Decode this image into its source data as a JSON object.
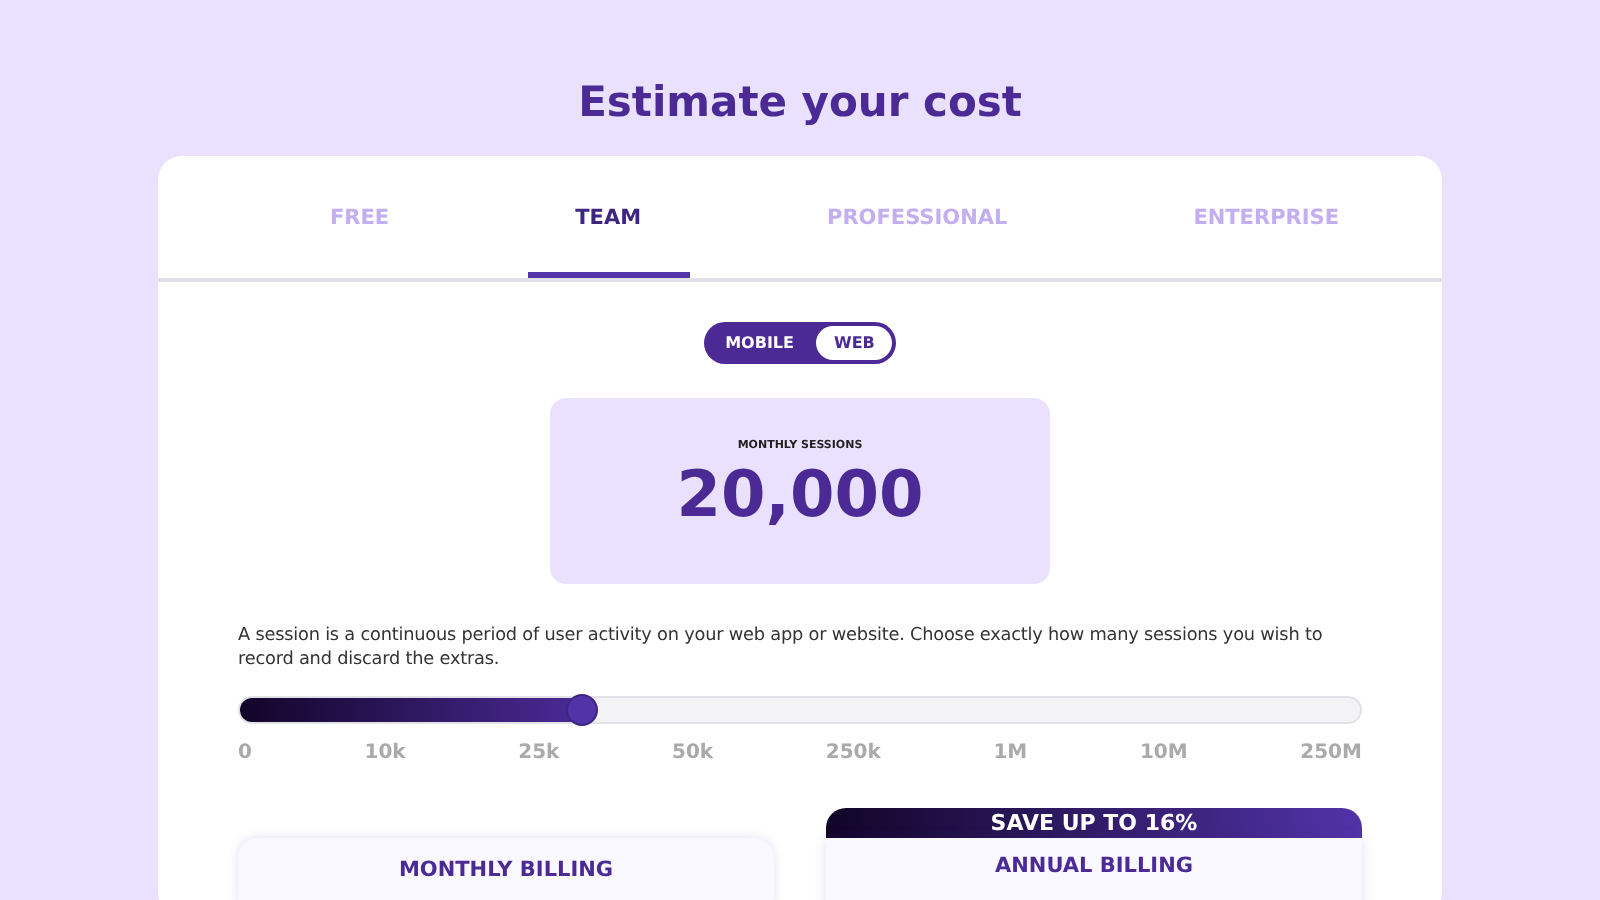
{
  "title": "Estimate your cost",
  "tabs": [
    {
      "label": "FREE",
      "selected": false
    },
    {
      "label": "TEAM",
      "selected": true
    },
    {
      "label": "PROFESSIONAL",
      "selected": false
    },
    {
      "label": "ENTERPRISE",
      "selected": false
    }
  ],
  "platform_toggle": [
    {
      "label": "MOBILE",
      "selected": false
    },
    {
      "label": "WEB",
      "selected": true
    }
  ],
  "sessions": {
    "label": "MONTHLY SESSIONS",
    "value": "20,000"
  },
  "description": "A session is a continuous period of user activity on your web app or website. Choose exactly how many sessions you wish to record and discard the extras.",
  "slider": {
    "level": 0.305,
    "ticks": [
      "0",
      "10k",
      "25k",
      "50k",
      "250k",
      "1M",
      "10M",
      "250M"
    ]
  },
  "billing": [
    {
      "label": "MONTHLY BILLING"
    },
    {
      "label": "ANNUAL BILLING",
      "banner": "SAVE UP TO 16%"
    }
  ]
}
